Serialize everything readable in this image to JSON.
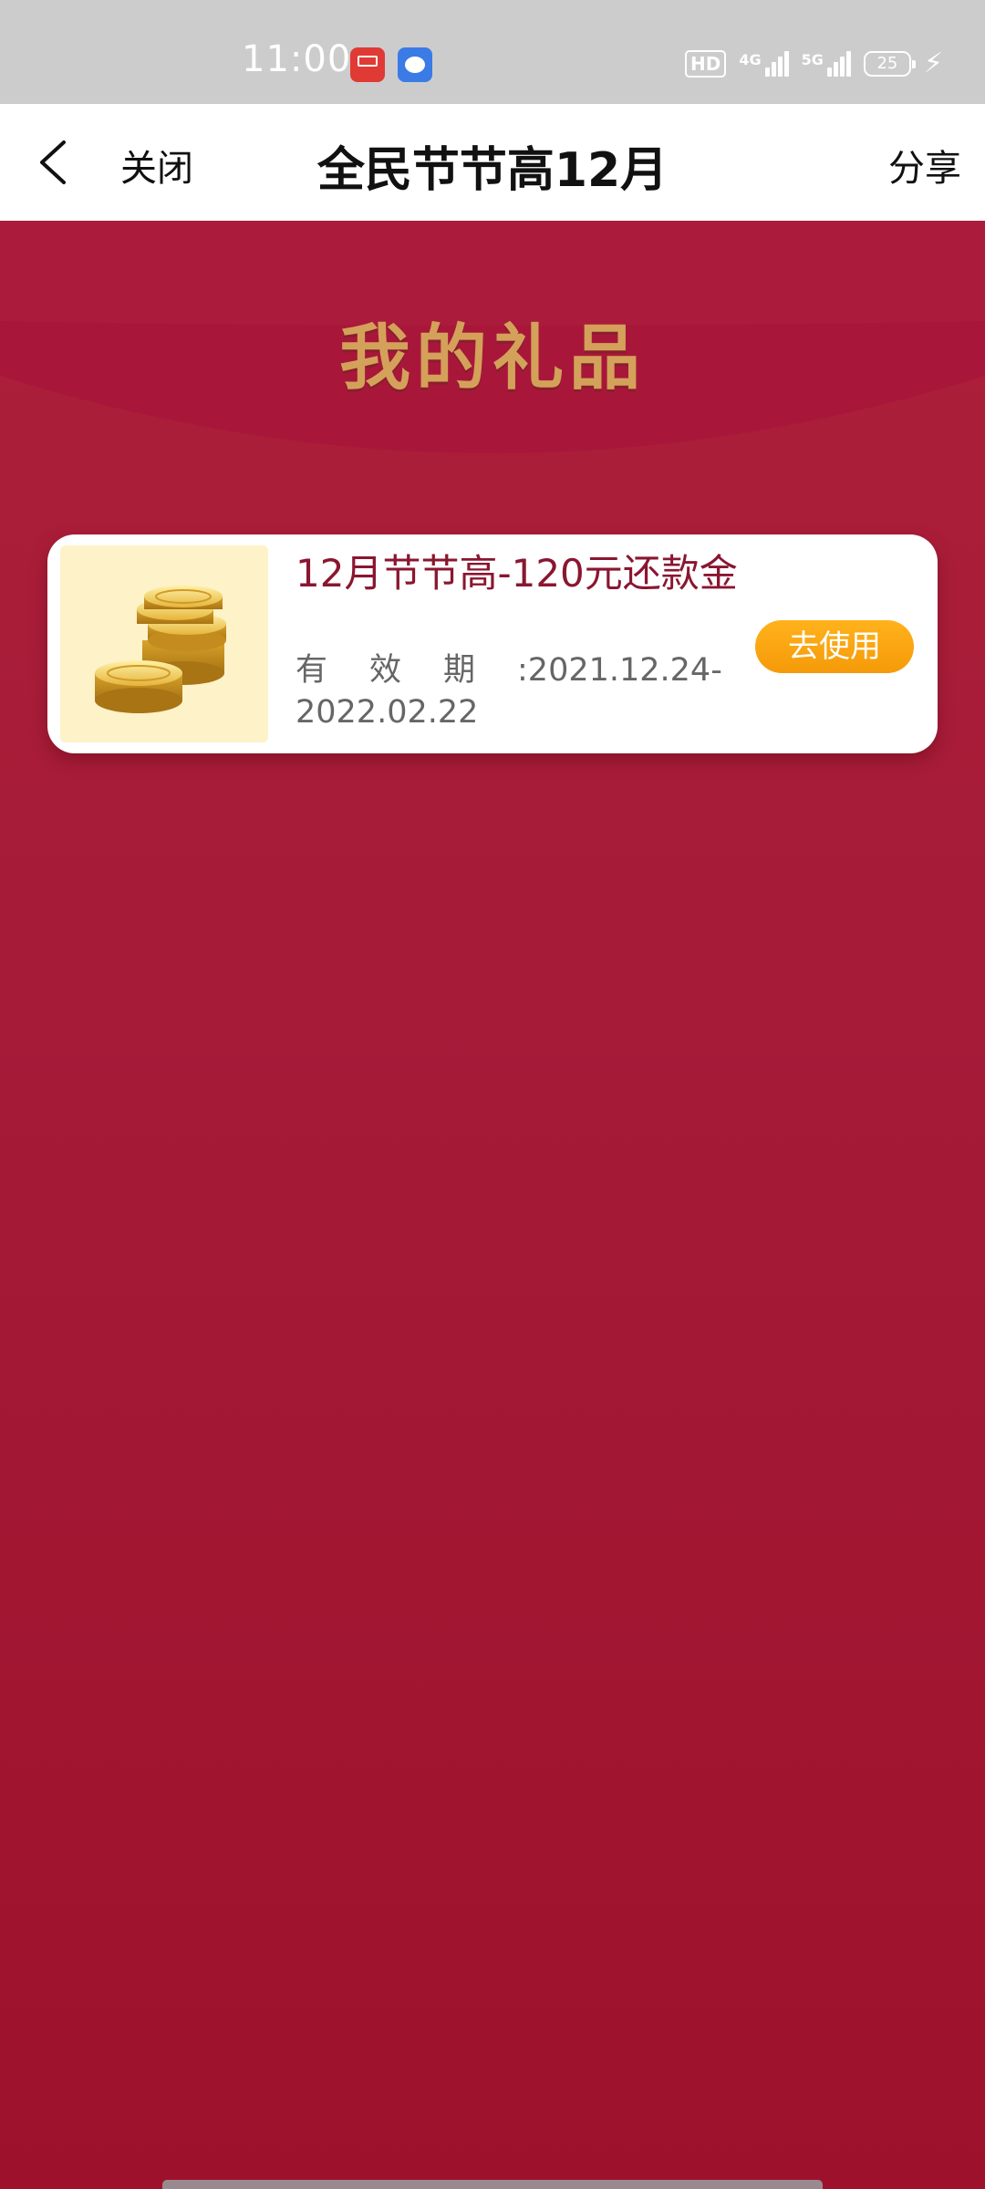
{
  "status_bar": {
    "time": "11:00",
    "hd_label": "HD",
    "network_1": "4G",
    "network_2": "5G",
    "battery_level": "25",
    "app_icons": [
      "calendar-icon",
      "chat-icon"
    ]
  },
  "nav": {
    "back_icon": "chevron-left-icon",
    "close_label": "关闭",
    "title": "全民节节高12月",
    "share_label": "分享"
  },
  "section": {
    "title": "我的礼品"
  },
  "gift": {
    "thumb_icon": "gold-coins-icon",
    "title": "12月节节高-120元还款金",
    "validity_label": "有效期",
    "validity_range": ":2021.12.24-2022.02.22",
    "action_label": "去使用"
  },
  "colors": {
    "page_red": "#a21a36",
    "title_gold": "#d4a15a",
    "button_orange": "#f8a20f",
    "gift_title": "#8a1630"
  }
}
